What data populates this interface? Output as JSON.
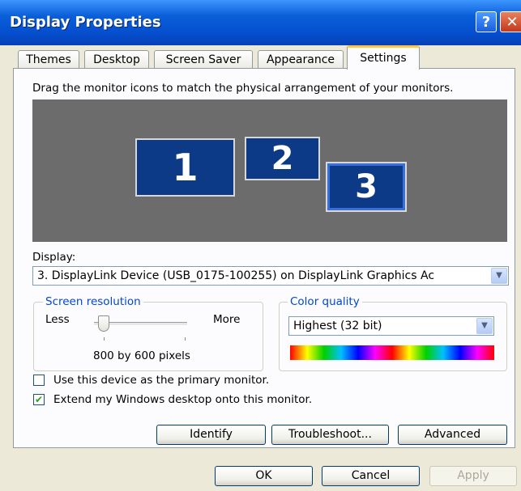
{
  "window": {
    "title": "Display Properties",
    "help_glyph": "?",
    "close_glyph": "✕"
  },
  "tabs": [
    {
      "label": "Themes"
    },
    {
      "label": "Desktop"
    },
    {
      "label": "Screen Saver"
    },
    {
      "label": "Appearance"
    },
    {
      "label": "Settings",
      "selected": true
    }
  ],
  "instructions": "Drag the monitor icons to match the physical arrangement of your monitors.",
  "monitors": [
    {
      "number": "1"
    },
    {
      "number": "2"
    },
    {
      "number": "3",
      "selected": true
    }
  ],
  "display": {
    "label": "Display:",
    "selected": "3. DisplayLink Device (USB_0175-100255) on DisplayLink Graphics Ac"
  },
  "screen_resolution": {
    "title": "Screen resolution",
    "less_label": "Less",
    "more_label": "More",
    "value_text": "800 by 600 pixels",
    "slider_position_fraction": 0.0
  },
  "color_quality": {
    "title": "Color quality",
    "selected": "Highest (32 bit)"
  },
  "checkboxes": {
    "primary": {
      "label": "Use this device as the primary monitor.",
      "checked": false
    },
    "extend": {
      "label": "Extend my Windows desktop onto this monitor.",
      "checked": true,
      "glyph": "✔"
    }
  },
  "action_buttons": {
    "identify": "Identify",
    "troubleshoot": "Troubleshoot...",
    "advanced": "Advanced"
  },
  "dialog_buttons": {
    "ok": "OK",
    "cancel": "Cancel",
    "apply": "Apply"
  },
  "colors": {
    "title_bar": "#0550d0",
    "monitor_fill": "#0d3a86",
    "monitor_area": "#6c6c6c",
    "group_title": "#0046d5",
    "active_tab_accent": "#ffc83c"
  }
}
